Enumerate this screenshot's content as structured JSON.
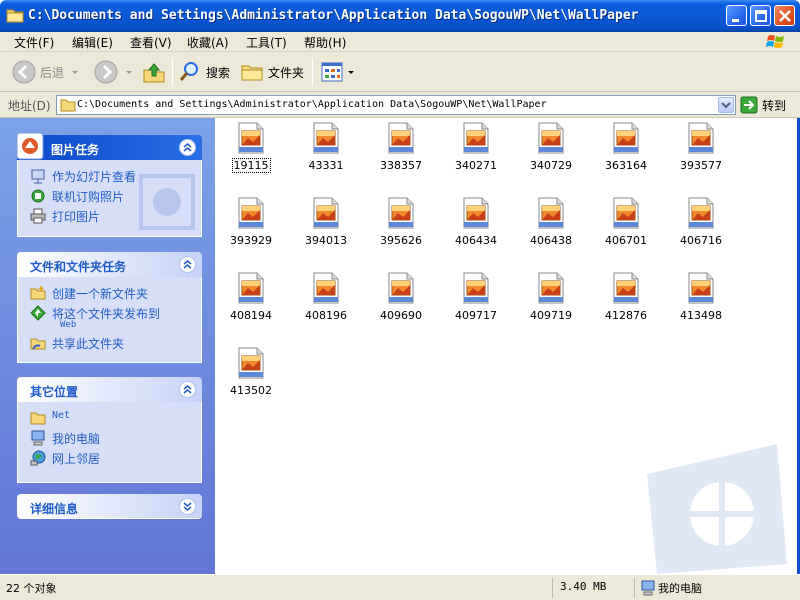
{
  "window": {
    "title": "C:\\Documents and Settings\\Administrator\\Application Data\\SogouWP\\Net\\WallPaper"
  },
  "menu": [
    "文件(F)",
    "编辑(E)",
    "查看(V)",
    "收藏(A)",
    "工具(T)",
    "帮助(H)"
  ],
  "toolbar": {
    "back_label": "后退",
    "search_label": "搜索",
    "folders_label": "文件夹"
  },
  "address": {
    "label": "地址(D)",
    "value": "C:\\Documents and Settings\\Administrator\\Application Data\\SogouWP\\Net\\WallPaper",
    "go_label": "转到"
  },
  "tasks": {
    "picture": {
      "title": "图片任务",
      "items": [
        "作为幻灯片查看",
        "联机订购照片",
        "打印图片"
      ]
    },
    "file_folder": {
      "title": "文件和文件夹任务",
      "items": [
        "创建一个新文件夹",
        "将这个文件夹发布到",
        "共享此文件夹"
      ],
      "publish_suffix": "Web"
    },
    "other_places": {
      "title": "其它位置",
      "items": [
        "Net",
        "我的电脑",
        "网上邻居"
      ]
    },
    "details": {
      "title": "详细信息"
    }
  },
  "files": [
    "19115",
    "43331",
    "338357",
    "340271",
    "340729",
    "363164",
    "393577",
    "393929",
    "394013",
    "395626",
    "406434",
    "406438",
    "406701",
    "406716",
    "408194",
    "408196",
    "409690",
    "409717",
    "409719",
    "412876",
    "413498",
    "413502"
  ],
  "status": {
    "count": "22 个对象",
    "size": "3.40 MB",
    "location": "我的电脑"
  },
  "colors": {
    "title_bar": "#0a58d6",
    "task_pane": "#6f8ee0",
    "link": "#215dc6"
  }
}
